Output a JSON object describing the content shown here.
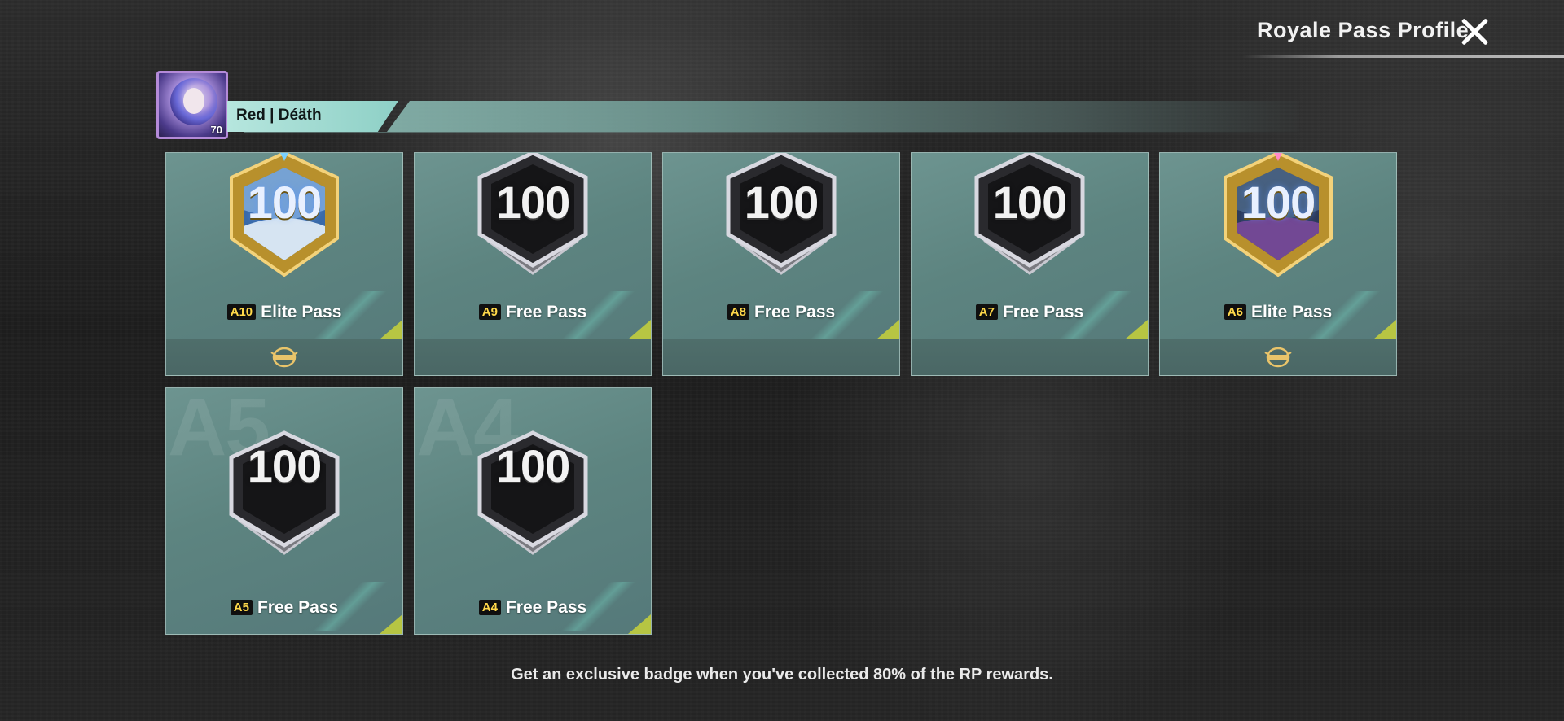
{
  "header": {
    "title": "Royale Pass Profile",
    "close_icon": "close-icon"
  },
  "player": {
    "name": "Red | Déäth",
    "level": "70"
  },
  "badges": [
    {
      "season": "A10",
      "pass": "Elite Pass",
      "value": "100",
      "type": "elite",
      "footer_icon": "elite-pass-icon"
    },
    {
      "season": "A9",
      "pass": "Free Pass",
      "value": "100",
      "type": "free"
    },
    {
      "season": "A8",
      "pass": "Free Pass",
      "value": "100",
      "type": "free"
    },
    {
      "season": "A7",
      "pass": "Free Pass",
      "value": "100",
      "type": "free"
    },
    {
      "season": "A6",
      "pass": "Elite Pass",
      "value": "100",
      "type": "elite",
      "footer_icon": "elite-pass-icon"
    },
    {
      "season": "A5",
      "pass": "Free Pass",
      "value": "100",
      "type": "free",
      "watermark": "A5"
    },
    {
      "season": "A4",
      "pass": "Free Pass",
      "value": "100",
      "type": "free",
      "watermark": "A4"
    }
  ],
  "footer": {
    "hint": "Get an exclusive badge when you've collected 80% of the RP rewards."
  },
  "colors": {
    "card": "#5d8480",
    "accent_green": "#c8d23a",
    "season_tag_text": "#ffd84a",
    "name_tag": "#8ed0c6"
  }
}
